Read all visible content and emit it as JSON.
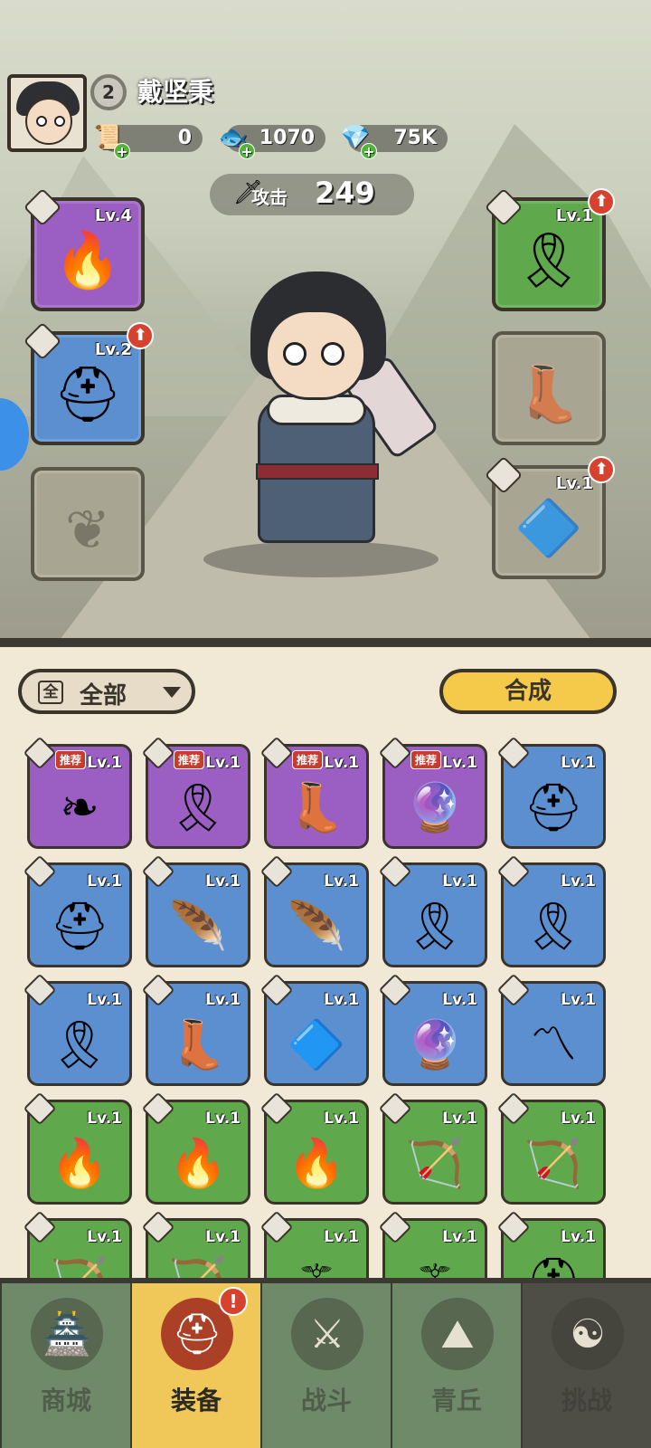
{
  "player": {
    "level": "2",
    "name": "戴坚秉"
  },
  "currencies": [
    {
      "icon": "scroll-icon",
      "value": "0"
    },
    {
      "icon": "jade-fish-icon",
      "value": "1070"
    },
    {
      "icon": "crystal-icon",
      "value": "75K"
    }
  ],
  "attack": {
    "label": "攻击",
    "value": "249"
  },
  "equipped": {
    "weapon": {
      "level": "Lv.4",
      "rarity": "purple",
      "icon": "flame-flail-icon"
    },
    "armor": {
      "level": "Lv.2",
      "rarity": "blue",
      "icon": "helmet-icon",
      "upgrade": true
    },
    "accessory": {
      "level": "",
      "rarity": "empty",
      "icon": "amulet-slot-icon"
    },
    "belt": {
      "level": "Lv.1",
      "rarity": "green",
      "icon": "belt-icon",
      "upgrade": true
    },
    "boots": {
      "level": "",
      "rarity": "empty",
      "icon": "boots-slot-icon"
    },
    "pendant": {
      "level": "Lv.1",
      "rarity": "empty",
      "icon": "pendant-icon",
      "upgrade": true
    }
  },
  "filter": {
    "badge": "全",
    "label": "全部"
  },
  "synth_label": "合成",
  "recommend_label": "推荐",
  "inventory": [
    {
      "level": "Lv.1",
      "rarity": "purple",
      "icon": "horn-accessory-icon",
      "recommended": true
    },
    {
      "level": "Lv.1",
      "rarity": "purple",
      "icon": "belt-icon",
      "recommended": true
    },
    {
      "level": "Lv.1",
      "rarity": "purple",
      "icon": "boots-icon",
      "recommended": true
    },
    {
      "level": "Lv.1",
      "rarity": "purple",
      "icon": "orb-pendant-icon",
      "recommended": true
    },
    {
      "level": "Lv.1",
      "rarity": "blue",
      "icon": "helmet-icon",
      "recommended": false
    },
    {
      "level": "Lv.1",
      "rarity": "blue",
      "icon": "helmet-icon",
      "recommended": false
    },
    {
      "level": "Lv.1",
      "rarity": "blue",
      "icon": "feather-ornament-icon",
      "recommended": false
    },
    {
      "level": "Lv.1",
      "rarity": "blue",
      "icon": "feather-ornament-icon",
      "recommended": false
    },
    {
      "level": "Lv.1",
      "rarity": "blue",
      "icon": "belt-icon",
      "recommended": false
    },
    {
      "level": "Lv.1",
      "rarity": "blue",
      "icon": "belt-icon",
      "recommended": false
    },
    {
      "level": "Lv.1",
      "rarity": "blue",
      "icon": "belt-icon",
      "recommended": false
    },
    {
      "level": "Lv.1",
      "rarity": "blue",
      "icon": "boots-icon",
      "recommended": false
    },
    {
      "level": "Lv.1",
      "rarity": "blue",
      "icon": "crystal-pendant-icon",
      "recommended": false
    },
    {
      "level": "Lv.1",
      "rarity": "blue",
      "icon": "orb-pendant-icon",
      "recommended": false
    },
    {
      "level": "Lv.1",
      "rarity": "blue",
      "icon": "fang-necklace-icon",
      "recommended": false
    },
    {
      "level": "Lv.1",
      "rarity": "green",
      "icon": "flame-flail-icon",
      "recommended": false
    },
    {
      "level": "Lv.1",
      "rarity": "green",
      "icon": "flame-flail-icon",
      "recommended": false
    },
    {
      "level": "Lv.1",
      "rarity": "green",
      "icon": "flame-flail-icon",
      "recommended": false
    },
    {
      "level": "Lv.1",
      "rarity": "green",
      "icon": "bow-icon",
      "recommended": false
    },
    {
      "level": "Lv.1",
      "rarity": "green",
      "icon": "bow-icon",
      "recommended": false
    },
    {
      "level": "Lv.1",
      "rarity": "green",
      "icon": "bow-icon",
      "recommended": false
    },
    {
      "level": "Lv.1",
      "rarity": "green",
      "icon": "bow-icon",
      "recommended": false
    },
    {
      "level": "Lv.1",
      "rarity": "green",
      "icon": "staff-icon",
      "recommended": false
    },
    {
      "level": "Lv.1",
      "rarity": "green",
      "icon": "staff-icon",
      "recommended": false
    },
    {
      "level": "Lv.1",
      "rarity": "green",
      "icon": "helmet-icon",
      "recommended": false
    }
  ],
  "nav": [
    {
      "label": "商城",
      "icon": "shop-icon",
      "state": "normal"
    },
    {
      "label": "装备",
      "icon": "equipment-icon",
      "state": "active",
      "alert": "!"
    },
    {
      "label": "战斗",
      "icon": "crossed-swords-icon",
      "state": "normal"
    },
    {
      "label": "青丘",
      "icon": "mountain-icon",
      "state": "normal"
    },
    {
      "label": "挑战",
      "icon": "challenge-icon",
      "state": "dim"
    }
  ],
  "colors": {
    "purple": "#9b5fc4",
    "blue": "#5b8fd0",
    "green": "#5fa84b",
    "accent_yellow": "#f5c949",
    "alert_red": "#d7422e"
  }
}
